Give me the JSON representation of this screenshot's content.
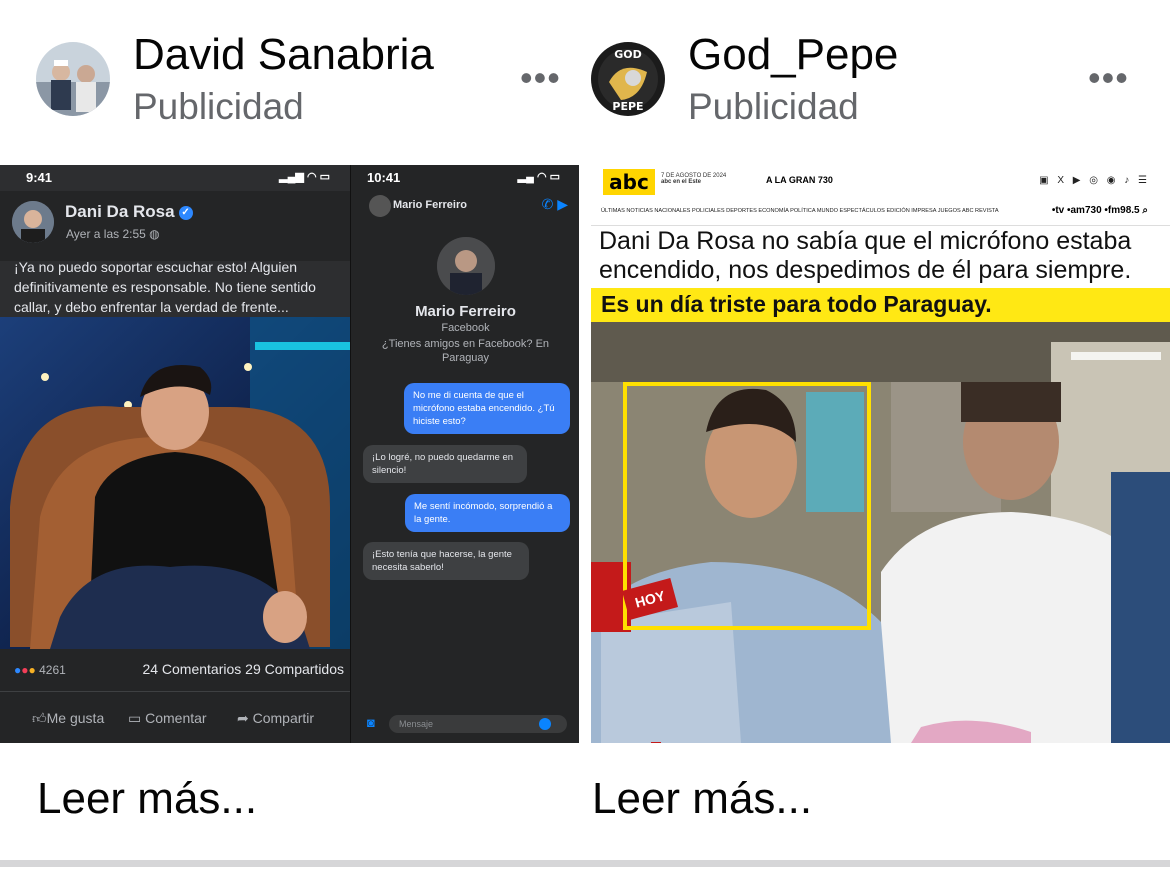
{
  "posts": [
    {
      "author": "David Sanabria",
      "sponsored": "Publicidad",
      "more": "•••",
      "read_more": "Leer más...",
      "fb_post": {
        "status_time": "9:41",
        "name": "Dani Da Rosa",
        "time": "Ayer a las 2:55",
        "text": "¡Ya no puedo soportar escuchar esto! Alguien definitivamente es responsable. No tiene sentido callar, y debo enfrentar la verdad de frente...",
        "reaction_count": "4261",
        "comments_shares": "24 Comentarios 29 Compartidos",
        "actions": [
          "Me gusta",
          "Comentar",
          "Compartir"
        ]
      },
      "messenger": {
        "status_time": "10:41",
        "title": "Mario Ferreiro",
        "name": "Mario Ferreiro",
        "platform": "Facebook",
        "friends_note": "¿Tienes amigos en Facebook? En Paraguay",
        "messages": [
          "No me di cuenta de que el micrófono estaba encendido. ¿Tú hiciste esto?",
          "¡Lo logré, no puedo quedarme en silencio!",
          "Me sentí incómodo, sorprendió a la gente.",
          "¡Esto tenía que hacerse, la gente necesita saberlo!"
        ],
        "input_placeholder": "Mensaje"
      }
    },
    {
      "author": "God_Pepe",
      "sponsored": "Publicidad",
      "more": "•••",
      "read_more": "Leer más...",
      "news": {
        "logo": "abc",
        "date": "7 DE AGOSTO DE 2024",
        "edition": "abc en el Este",
        "tv": "A LA GRAN 730",
        "nav": "ÚLTIMAS NOTICIAS  NACIONALES  POLICIALES  DEPORTES  ECONOMÍA  POLÍTICA  MUNDO  ESPECTÁCULOS  EDICIÓN IMPRESA  JUEGOS  ABC REVISTA",
        "radio": "•tv •am730 •fm98.5",
        "headline": "Dani Da Rosa no sabía que el micrófono estaba encendido, nos despedimos de él para siempre.",
        "banner": "Es un día triste para todo Paraguay.",
        "mic_label": "HOY"
      }
    }
  ]
}
